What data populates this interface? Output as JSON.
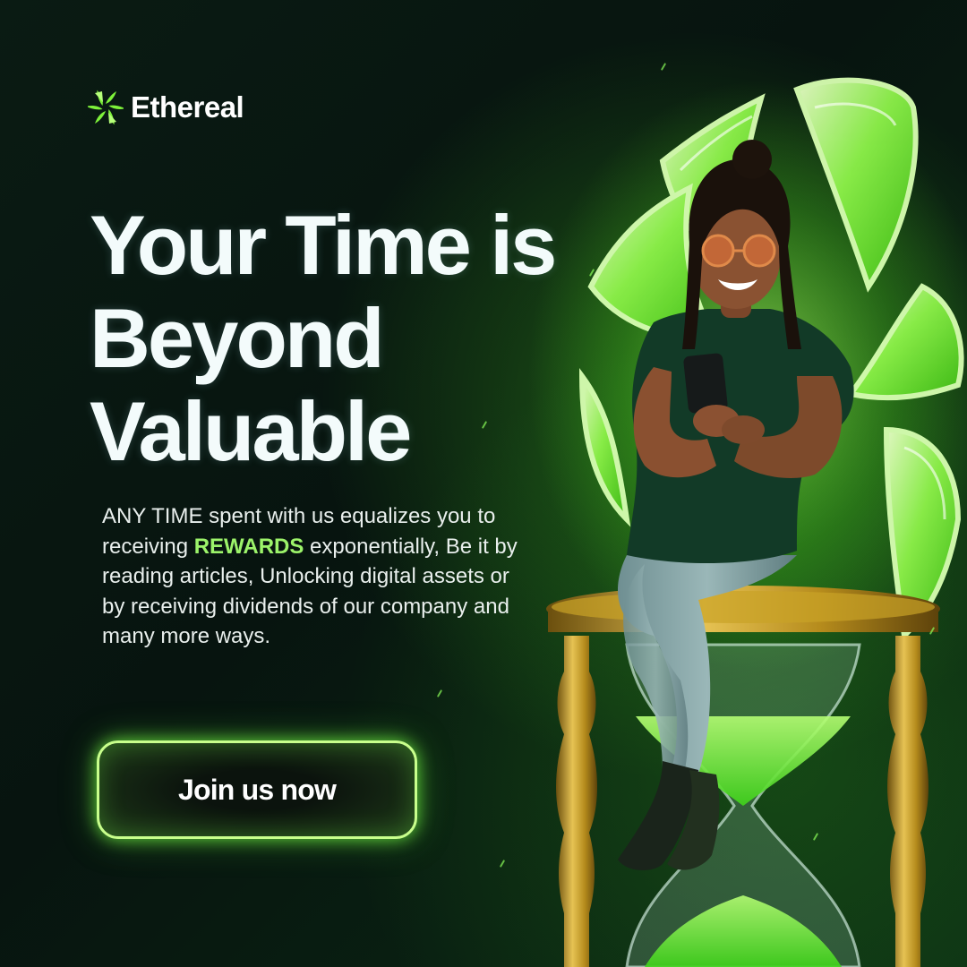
{
  "brand": {
    "name": "Ethereal",
    "icon": "pinwheel-logo-icon",
    "accent": "#9cf36a"
  },
  "headline": {
    "line1": "Your Time is",
    "line2": "Beyond",
    "line3": "Valuable"
  },
  "body": {
    "part1": "ANY TIME spent with us equalizes you to receiving ",
    "highlight": "REWARDS",
    "part2": " exponentially, Be it by reading articles, Unlocking digital assets or by receiving dividends of our company and many more ways."
  },
  "cta": {
    "label": "Join us now"
  },
  "colors": {
    "background": "#07140f",
    "glow": "#57ff28",
    "gold": "#c9a227"
  }
}
